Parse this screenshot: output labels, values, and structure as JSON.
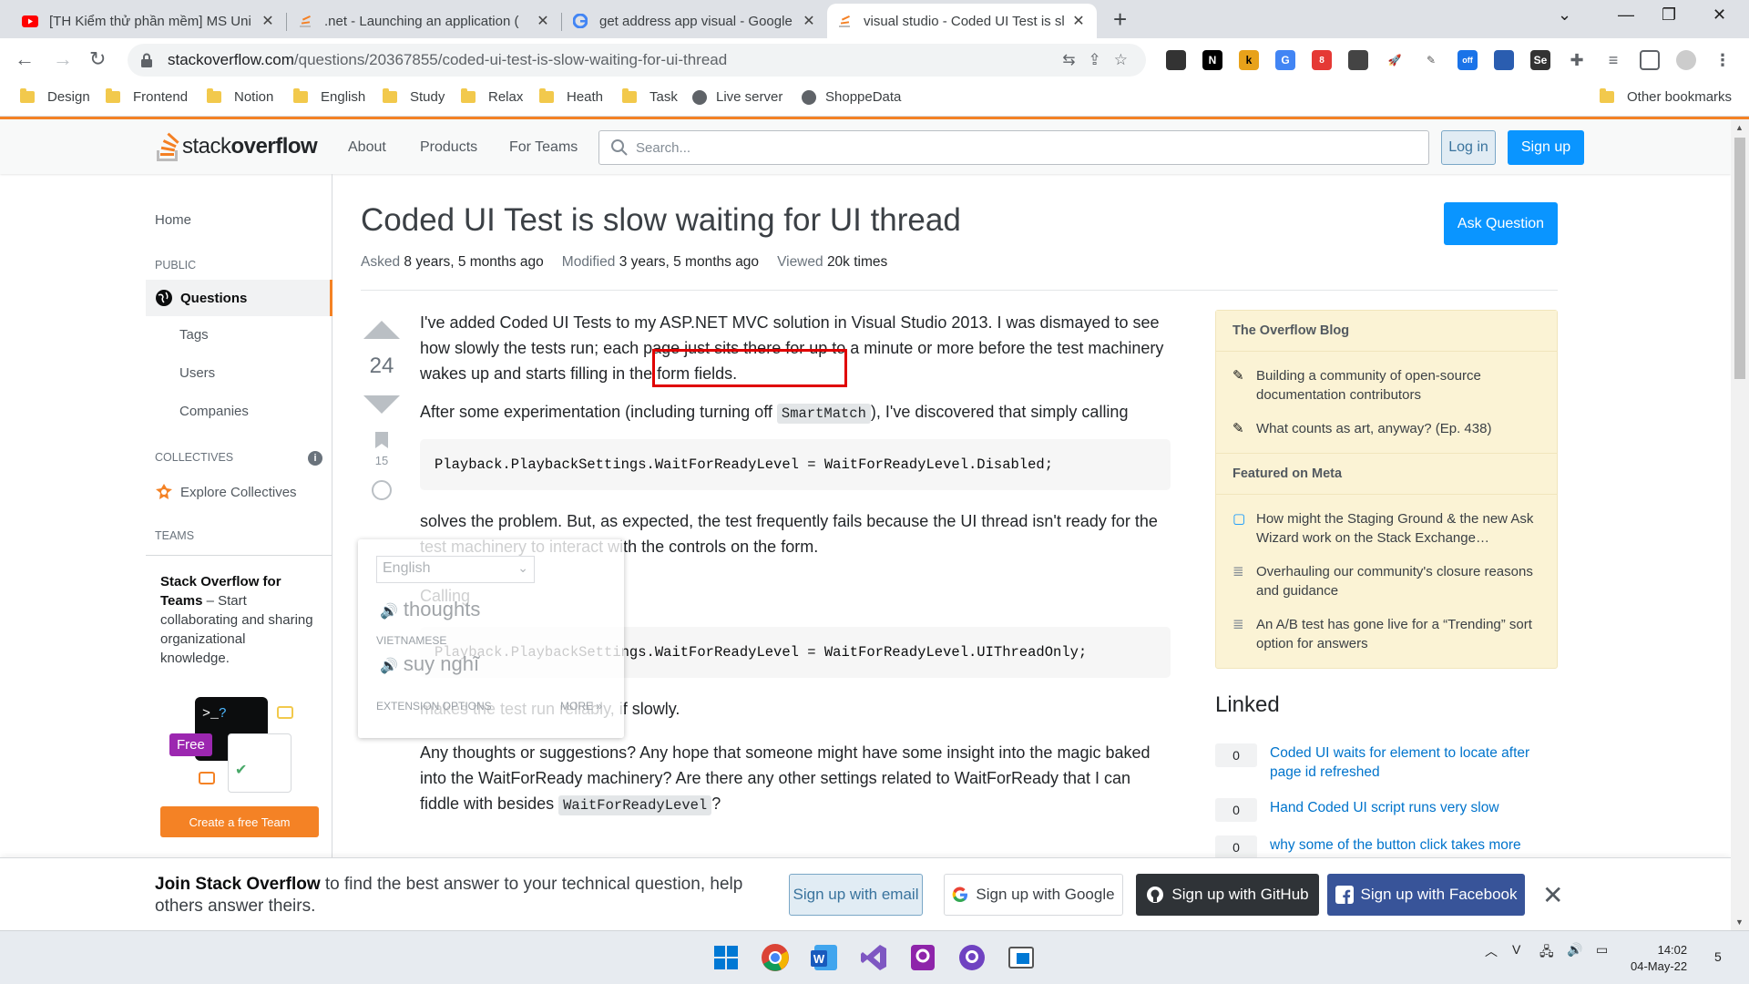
{
  "browser": {
    "tabs": [
      {
        "title": "[TH Kiểm thử phần mềm] MS Uni",
        "favicon": "youtube-icon",
        "active": false
      },
      {
        "title": ".net - Launching an application (",
        "favicon": "stackoverflow-icon",
        "active": false
      },
      {
        "title": "get address app visual - Google S",
        "favicon": "google-icon",
        "active": false
      },
      {
        "title": "visual studio - Coded UI Test is sl",
        "favicon": "stackoverflow-icon",
        "active": true
      }
    ],
    "url_host": "stackoverflow.com",
    "url_path": "/questions/20367855/coded-ui-test-is-slow-waiting-for-ui-thread",
    "bookmarks": [
      "Design",
      "Frontend",
      "Notion",
      "English",
      "Study",
      "Relax",
      "Heath",
      "Task",
      "Live server",
      "ShoppeData"
    ],
    "other_bookmarks": "Other bookmarks",
    "extension_badge": "8",
    "extension_off": "off"
  },
  "so": {
    "logo_left": "stack",
    "logo_right": "overflow",
    "nav": [
      "About",
      "Products",
      "For Teams"
    ],
    "search_placeholder": "Search...",
    "login": "Log in",
    "signup": "Sign up"
  },
  "leftnav": {
    "home": "Home",
    "public": "PUBLIC",
    "questions": "Questions",
    "tags": "Tags",
    "users": "Users",
    "companies": "Companies",
    "collectives": "COLLECTIVES",
    "explore_collectives": "Explore Collectives",
    "teams": "TEAMS",
    "teams_title": "Stack Overflow for Teams",
    "teams_desc": " – Start collaborating and sharing organizational knowledge.",
    "free_badge": "Free",
    "create_team": "Create a free Team"
  },
  "question": {
    "title": "Coded UI Test is slow waiting for UI thread",
    "asked_label": "Asked",
    "asked": "8 years, 5 months ago",
    "modified_label": "Modified",
    "modified": "3 years, 5 months ago",
    "viewed_label": "Viewed",
    "viewed": "20k times",
    "ask_button": "Ask Question",
    "votes": "24",
    "bookmarks": "15",
    "p1": "I've added Coded UI Tests to my ASP.NET MVC solution in Visual Studio 2013. I was dismayed to see how slowly the tests run; each page just sits there for up to a minute or more before the test machinery wakes up and starts filling in the form fields.",
    "p2a": "After some experimentation (including turning off ",
    "p2code": "SmartMatch",
    "p2b": "), I've discovered that simply calling",
    "code1": "Playback.PlaybackSettings.WaitForReadyLevel = WaitForReadyLevel.Disabled;",
    "p3": "solves the problem. But, as expected, the test frequently fails because the UI thread isn't ready for the test machinery to interact with the controls on the form.",
    "p4": "Calling",
    "code2": "Playback.PlaybackSettings.WaitForReadyLevel = WaitForReadyLevel.UIThreadOnly;",
    "p5": "makes the test run reliably, if slowly.",
    "p6a": "Any thoughts or suggestions? Any hope that someone might have some insight into the magic baked into the WaitForReady machinery? Are there any other settings related to WaitForReady that I can fiddle with besides ",
    "p6code": "WaitForReadyLevel",
    "p6b": "?"
  },
  "translate_popup": {
    "language": "English",
    "source_word": "thoughts",
    "target_label": "VIETNAMESE",
    "target_word": "suy nghĩ",
    "extension_options": "EXTENSION OPTIONS",
    "more": "MORE »"
  },
  "sidebar": {
    "blog_title": "The Overflow Blog",
    "blog_items": [
      "Building a community of open-source documentation contributors",
      "What counts as art, anyway? (Ep. 438)"
    ],
    "meta_title": "Featured on Meta",
    "meta_items": [
      "How might the Staging Ground & the new Ask Wizard work on the Stack Exchange…",
      "Overhauling our community's closure reasons and guidance",
      "An A/B test has gone live for a “Trending” sort option for answers"
    ],
    "linked_title": "Linked",
    "linked": [
      {
        "count": "0",
        "text": "Coded UI waits for element to locate after page id refreshed"
      },
      {
        "count": "0",
        "text": "Hand Coded UI script runs very slow"
      },
      {
        "count": "0",
        "text": "why some of the button click takes more"
      }
    ]
  },
  "banner": {
    "join_bold": "Join Stack Overflow",
    "join_rest": " to find the best answer to your technical question, help others answer theirs.",
    "email": "Sign up with email",
    "google": "Sign up with Google",
    "github": "Sign up with GitHub",
    "facebook": "Sign up with Facebook"
  },
  "taskbar": {
    "time": "14:02",
    "date": "04-May-22",
    "notifications": "5"
  }
}
